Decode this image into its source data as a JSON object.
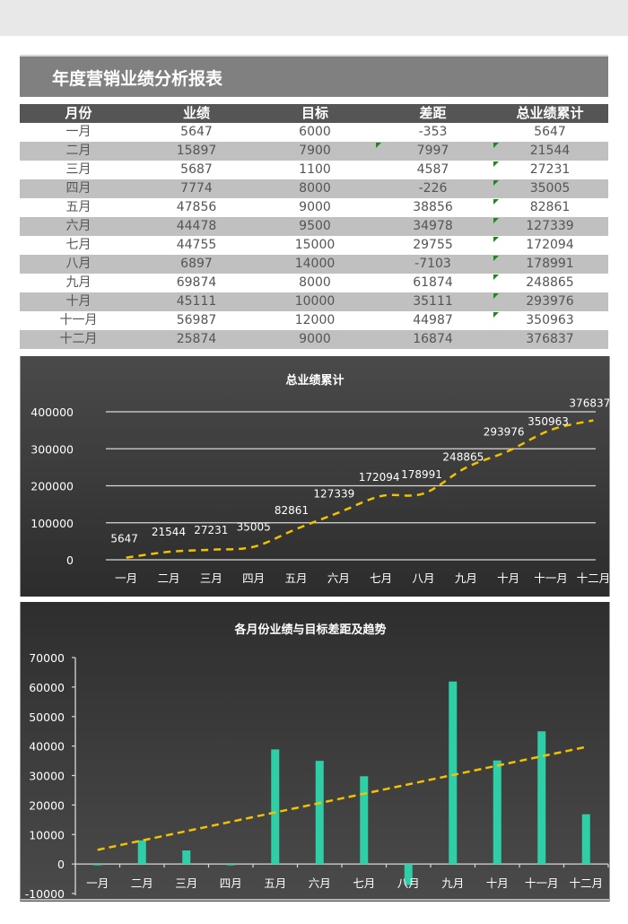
{
  "report": {
    "title": "年度营销业绩分析报表",
    "headers": [
      "月份",
      "业绩",
      "目标",
      "差距",
      "总业绩累计"
    ],
    "rows": [
      {
        "month": "一月",
        "sales": "5647",
        "target": "6000",
        "gap": "-353",
        "cumulative": "5647",
        "gap_flag": false,
        "cum_flag": false
      },
      {
        "month": "二月",
        "sales": "15897",
        "target": "7900",
        "gap": "7997",
        "cumulative": "21544",
        "gap_flag": true,
        "cum_flag": true
      },
      {
        "month": "三月",
        "sales": "5687",
        "target": "1100",
        "gap": "4587",
        "cumulative": "27231",
        "gap_flag": false,
        "cum_flag": true
      },
      {
        "month": "四月",
        "sales": "7774",
        "target": "8000",
        "gap": "-226",
        "cumulative": "35005",
        "gap_flag": false,
        "cum_flag": true
      },
      {
        "month": "五月",
        "sales": "47856",
        "target": "9000",
        "gap": "38856",
        "cumulative": "82861",
        "gap_flag": false,
        "cum_flag": true
      },
      {
        "month": "六月",
        "sales": "44478",
        "target": "9500",
        "gap": "34978",
        "cumulative": "127339",
        "gap_flag": false,
        "cum_flag": true
      },
      {
        "month": "七月",
        "sales": "44755",
        "target": "15000",
        "gap": "29755",
        "cumulative": "172094",
        "gap_flag": false,
        "cum_flag": true
      },
      {
        "month": "八月",
        "sales": "6897",
        "target": "14000",
        "gap": "-7103",
        "cumulative": "178991",
        "gap_flag": false,
        "cum_flag": true
      },
      {
        "month": "九月",
        "sales": "69874",
        "target": "8000",
        "gap": "61874",
        "cumulative": "248865",
        "gap_flag": false,
        "cum_flag": true
      },
      {
        "month": "十月",
        "sales": "45111",
        "target": "10000",
        "gap": "35111",
        "cumulative": "293976",
        "gap_flag": false,
        "cum_flag": true
      },
      {
        "month": "十一月",
        "sales": "56987",
        "target": "12000",
        "gap": "44987",
        "cumulative": "350963",
        "gap_flag": false,
        "cum_flag": true
      },
      {
        "month": "十二月",
        "sales": "25874",
        "target": "9000",
        "gap": "16874",
        "cumulative": "376837",
        "gap_flag": false,
        "cum_flag": false
      }
    ]
  },
  "colors": {
    "title_bar": "#808080",
    "header_row": "#555555",
    "alt_row": "#c0c0c0",
    "line": "#f2c200",
    "bar": "#2ecfa6",
    "flag": "#1a8a1a"
  },
  "chart_data": [
    {
      "type": "line",
      "title": "总业绩累计",
      "categories": [
        "一月",
        "二月",
        "三月",
        "四月",
        "五月",
        "六月",
        "七月",
        "八月",
        "九月",
        "十月",
        "十一月",
        "十二月"
      ],
      "series": [
        {
          "name": "总业绩累计",
          "values": [
            5647,
            21544,
            27231,
            35005,
            82861,
            127339,
            172094,
            178991,
            248865,
            293976,
            350963,
            376837
          ],
          "style": "dashed",
          "smooth": true
        }
      ],
      "data_labels": [
        "5647",
        "21544",
        "27231",
        "35005",
        "82861",
        "127339",
        "172094",
        "178991",
        "248865",
        "293976",
        "350963",
        "376837"
      ],
      "ylim": [
        0,
        400000
      ],
      "yticks": [
        "0",
        "100000",
        "200000",
        "300000",
        "400000"
      ],
      "xlabel": "",
      "ylabel": "",
      "grid": true,
      "legend": "none"
    },
    {
      "type": "bar",
      "title": "各月份业绩与目标差距及趋势",
      "categories": [
        "一月",
        "二月",
        "三月",
        "四月",
        "五月",
        "六月",
        "七月",
        "八月",
        "九月",
        "十月",
        "十一月",
        "十二月"
      ],
      "series": [
        {
          "name": "差距",
          "values": [
            -353,
            7997,
            4587,
            -226,
            38856,
            34978,
            29755,
            -7103,
            61874,
            35111,
            44987,
            16874
          ]
        }
      ],
      "trendline": {
        "type": "linear",
        "style": "dashed",
        "start": 4800,
        "end": 39700
      },
      "ylim": [
        -10000,
        70000
      ],
      "yticks": [
        "-10000",
        "0",
        "10000",
        "20000",
        "30000",
        "40000",
        "50000",
        "60000",
        "70000"
      ],
      "xlabel": "",
      "ylabel": "",
      "grid": false,
      "legend": "none"
    }
  ]
}
